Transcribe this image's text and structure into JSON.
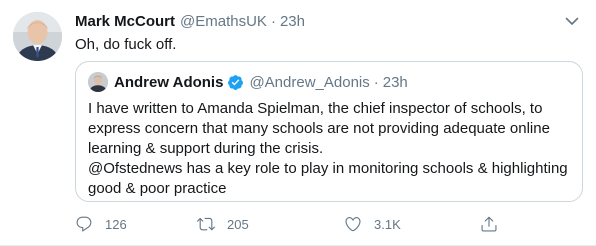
{
  "tweet": {
    "author_name": "Mark McCourt",
    "author_handle": "@EmathsUK",
    "separator": "·",
    "time": "23h",
    "text": "Oh, do fuck off."
  },
  "quoted_tweet": {
    "author_name": "Andrew Adonis",
    "author_handle": "@Andrew_Adonis",
    "separator": "·",
    "time": "23h",
    "lines": [
      "I have written to Amanda Spielman, the chief inspector of schools, to",
      "express concern that many schools are not providing adequate online",
      "learning & support during the crisis.",
      "@Ofstednews has a key role to play in monitoring schools & highlighting",
      "good & poor practice"
    ]
  },
  "actions": {
    "reply_count": "126",
    "retweet_count": "205",
    "like_count": "3.1K"
  },
  "colors": {
    "text_primary": "#14171a",
    "text_secondary": "#657786",
    "border": "#ccd6dd",
    "verified_blue": "#1da1f2"
  }
}
